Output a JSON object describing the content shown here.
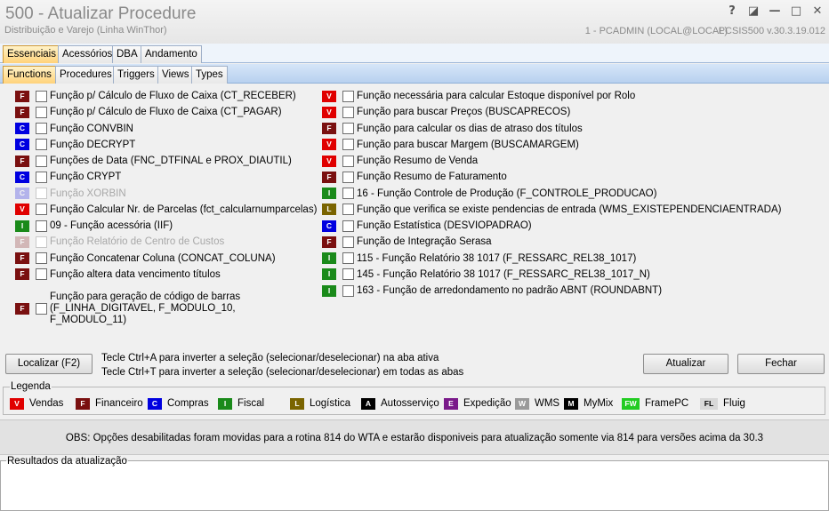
{
  "window": {
    "title": "500 - Atualizar Procedure",
    "subtitle": "Distribuição e Varejo (Linha WinThor)",
    "connection": "1 - PCADMIN (LOCAL@LOCAL)",
    "rotina": "PCSIS500  v.30.3.19.012",
    "btn_help": "?",
    "btn_restore": "◪",
    "btn_minimize": "—",
    "btn_maximize": "□",
    "btn_close": "✕"
  },
  "colors": {
    "V": "#e00000",
    "F": "#7a1010",
    "C": "#0000e0",
    "I": "#1a8a1a",
    "L": "#7a6400",
    "A": "#000000",
    "E": "#7a1a8a",
    "W": "#9a9a9a",
    "M": "#000000",
    "FW": "#22cc22",
    "FL": "#d8d8d8"
  },
  "tabs_main": [
    {
      "label": "Essenciais",
      "active": true
    },
    {
      "label": "Acessórios",
      "active": false
    },
    {
      "label": "DBA",
      "active": false
    },
    {
      "label": "Andamento",
      "active": false
    }
  ],
  "tabs_sub": [
    {
      "label": "Functions",
      "active": true
    },
    {
      "label": "Procedures",
      "active": false
    },
    {
      "label": "Triggers",
      "active": false
    },
    {
      "label": "Views",
      "active": false
    },
    {
      "label": "Types",
      "active": false
    }
  ],
  "functions_left": [
    {
      "badge": "F",
      "label": "Função p/ Cálculo de Fluxo de Caixa (CT_RECEBER)",
      "checked": false,
      "enabled": true
    },
    {
      "badge": "F",
      "label": "Função p/ Cálculo de Fluxo de Caixa (CT_PAGAR)",
      "checked": false,
      "enabled": true
    },
    {
      "badge": "C",
      "label": "Função CONVBIN",
      "checked": false,
      "enabled": true
    },
    {
      "badge": "C",
      "label": "Função DECRYPT",
      "checked": false,
      "enabled": true
    },
    {
      "badge": "F",
      "label": "Funções de Data (FNC_DTFINAL e PROX_DIAUTIL)",
      "checked": false,
      "enabled": true
    },
    {
      "badge": "C",
      "label": "Função CRYPT",
      "checked": false,
      "enabled": true
    },
    {
      "badge": "C",
      "label": "Função XORBIN",
      "checked": false,
      "enabled": false
    },
    {
      "badge": "V",
      "label": "Função Calcular Nr. de Parcelas (fct_calcularnumparcelas)",
      "checked": false,
      "enabled": true
    },
    {
      "badge": "I",
      "label": "09 - Função acessória (IIF)",
      "checked": false,
      "enabled": true
    },
    {
      "badge": "F",
      "label": "Função Relatório de Centro de Custos",
      "checked": false,
      "enabled": false
    },
    {
      "badge": "F",
      "label": "Função Concatenar Coluna (CONCAT_COLUNA)",
      "checked": false,
      "enabled": true
    },
    {
      "badge": "F",
      "label": "Função altera data vencimento títulos",
      "checked": false,
      "enabled": true
    },
    {
      "badge": "F",
      "label": "Função para geração de código de barras\n(F_LINHA_DIGITAVEL, F_MODULO_10,\nF_MODULO_11)",
      "checked": false,
      "enabled": true
    }
  ],
  "functions_right": [
    {
      "badge": "V",
      "label": "Função necessária para calcular Estoque disponível por Rolo",
      "checked": false,
      "enabled": true
    },
    {
      "badge": "V",
      "label": "Função para buscar Preços (BUSCAPRECOS)",
      "checked": false,
      "enabled": true
    },
    {
      "badge": "F",
      "label": "Função para calcular os dias de atraso dos títulos",
      "checked": false,
      "enabled": true
    },
    {
      "badge": "V",
      "label": "Função para buscar Margem (BUSCAMARGEM)",
      "checked": false,
      "enabled": true
    },
    {
      "badge": "V",
      "label": "Função Resumo de Venda",
      "checked": false,
      "enabled": true
    },
    {
      "badge": "F",
      "label": "Função Resumo de Faturamento",
      "checked": false,
      "enabled": true
    },
    {
      "badge": "I",
      "label": "16 - Função Controle de Produção (F_CONTROLE_PRODUCAO)",
      "checked": false,
      "enabled": true
    },
    {
      "badge": "L",
      "label": "Função que verifica se existe pendencias de entrada (WMS_EXISTEPENDENCIAENTRADA)",
      "checked": false,
      "enabled": true
    },
    {
      "badge": "C",
      "label": "Função Estatística (DESVIOPADRAO)",
      "checked": false,
      "enabled": true
    },
    {
      "badge": "F",
      "label": "Função de Integração Serasa",
      "checked": false,
      "enabled": true
    },
    {
      "badge": "I",
      "label": "115 - Função Relatório 38 1017 (F_RESSARC_REL38_1017)",
      "checked": false,
      "enabled": true
    },
    {
      "badge": "I",
      "label": "145 - Função Relatório 38 1017 (F_RESSARC_REL38_1017_N)",
      "checked": false,
      "enabled": true
    },
    {
      "badge": "I",
      "label": "163 - Função de arredondamento no padrão ABNT (ROUNDABNT)",
      "checked": false,
      "enabled": true
    }
  ],
  "actions": {
    "localizar": "Localizar (F2)",
    "hint1": "Tecle Ctrl+A para inverter a seleção (selecionar/deselecionar) na aba ativa",
    "hint2": "Tecle Ctrl+T para inverter a seleção (selecionar/deselecionar) em todas as abas",
    "atualizar": "Atualizar",
    "fechar": "Fechar"
  },
  "legend": {
    "title": "Legenda",
    "items": [
      {
        "code": "V",
        "label": "Vendas"
      },
      {
        "code": "F",
        "label": "Financeiro"
      },
      {
        "code": "C",
        "label": "Compras"
      },
      {
        "code": "I",
        "label": "Fiscal"
      },
      {
        "code": "L",
        "label": "Logística"
      },
      {
        "code": "A",
        "label": "Autosserviço"
      },
      {
        "code": "E",
        "label": "Expedição"
      },
      {
        "code": "W",
        "label": "WMS"
      },
      {
        "code": "M",
        "label": "MyMix"
      },
      {
        "code": "FW",
        "label": "FramePC"
      },
      {
        "code": "FL",
        "label": "Fluig"
      }
    ]
  },
  "obs": "OBS: Opções desabilitadas foram movidas para a rotina 814 do WTA e estarão disponiveis para atualização somente via 814 para versões acima da 30.3",
  "results": {
    "title": "Resultados da atualização"
  }
}
